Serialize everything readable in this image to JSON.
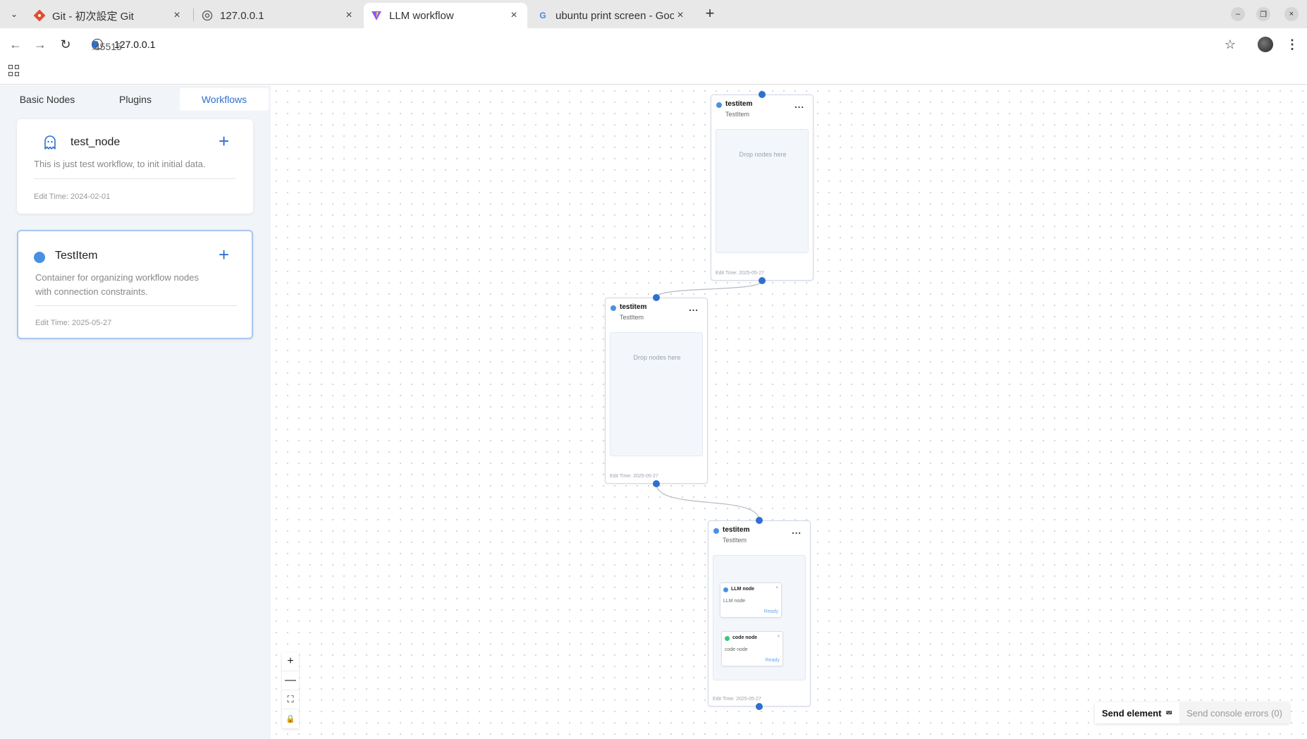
{
  "browser": {
    "tabs": [
      {
        "title": "Git - 初次設定 Git",
        "favicon": "git-favicon",
        "active": false
      },
      {
        "title": "127.0.0.1",
        "favicon": "globe-favicon",
        "active": false
      },
      {
        "title": "LLM workflow",
        "favicon": "vite-favicon",
        "active": true
      },
      {
        "title": "ubuntu print screen - Goo",
        "favicon": "google-favicon",
        "active": false
      }
    ],
    "url_host": "127.0.0.1",
    "url_port": ":45515"
  },
  "sidebar": {
    "tabs": [
      {
        "label": "Basic Nodes",
        "active": false
      },
      {
        "label": "Plugins",
        "active": false
      },
      {
        "label": "Workflows",
        "active": true
      }
    ],
    "cards": [
      {
        "icon": "ghost-icon",
        "title": "test_node",
        "description": "This is just test workflow, to init initial data.",
        "time": "Edit Time: 2024-02-01"
      },
      {
        "icon": "blue-dot-icon",
        "title": "TestItem",
        "description_lines": [
          "Container for organizing workflow nodes",
          "with connection constraints."
        ],
        "time": "Edit Time: 2025-05-27"
      }
    ]
  },
  "canvas": {
    "nodes": [
      {
        "title": "testitem",
        "subtitle": "TestItem",
        "menu": "...",
        "drop_text": "Drop nodes here",
        "time": "Edit Time: 2025-05-27"
      },
      {
        "title": "testitem",
        "subtitle": "TestItem",
        "menu": "...",
        "drop_text": "Drop nodes here",
        "time": "Edit Time: 2025-05-27"
      },
      {
        "title": "testitem",
        "subtitle": "TestItem",
        "menu": "...",
        "time": "Edit Time: 2025-05-27",
        "children": [
          {
            "title": "LLM node",
            "text": "LLM node",
            "status": "Ready",
            "color": "#4a90e2",
            "close": "×"
          },
          {
            "title": "code node",
            "text": "code node",
            "status": "Ready",
            "color": "#3cc47c",
            "close": "×"
          }
        ]
      }
    ],
    "zoom_controls": {
      "zoom_in": "+",
      "zoom_out": "—",
      "fit": "⛶",
      "lock": "🔒"
    }
  },
  "footer": {
    "send_element": "Send element",
    "send_console_errors": "Send console errors (0)"
  },
  "colors": {
    "accent": "#2f6fd1",
    "node_dot": "#4a90e2",
    "code_dot": "#3cc47c"
  }
}
